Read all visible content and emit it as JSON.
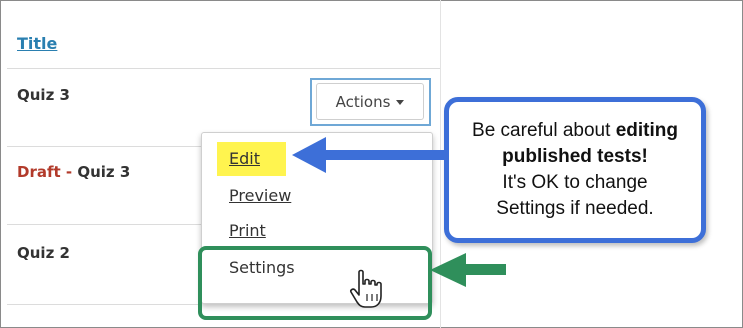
{
  "table": {
    "header": "Title",
    "rows": [
      {
        "name": "Quiz 3",
        "prefix": ""
      },
      {
        "name": "Quiz 3",
        "prefix": "Draft"
      },
      {
        "name": "Quiz 2",
        "prefix": ""
      }
    ],
    "draft_separator": " - "
  },
  "actions_button": {
    "label": "Actions"
  },
  "dropdown": {
    "items": [
      {
        "label": "Edit"
      },
      {
        "label": "Preview"
      },
      {
        "label": "Print"
      },
      {
        "label": "Settings"
      }
    ]
  },
  "callout": {
    "line1_pre": "Be careful about ",
    "line1_bold": "editing",
    "line2_bold": "published tests!",
    "line3": "It's OK to change",
    "line4": "Settings if needed."
  },
  "colors": {
    "link": "#2a7fb0",
    "draft": "#b23a2a",
    "highlight": "#fff44f",
    "callout_border": "#3d6fd8",
    "green_annotation": "#2f8f5b"
  },
  "icons": [
    "caret-down-icon",
    "hand-pointer-cursor-icon",
    "arrow-left-blue-icon",
    "arrow-left-green-icon"
  ]
}
